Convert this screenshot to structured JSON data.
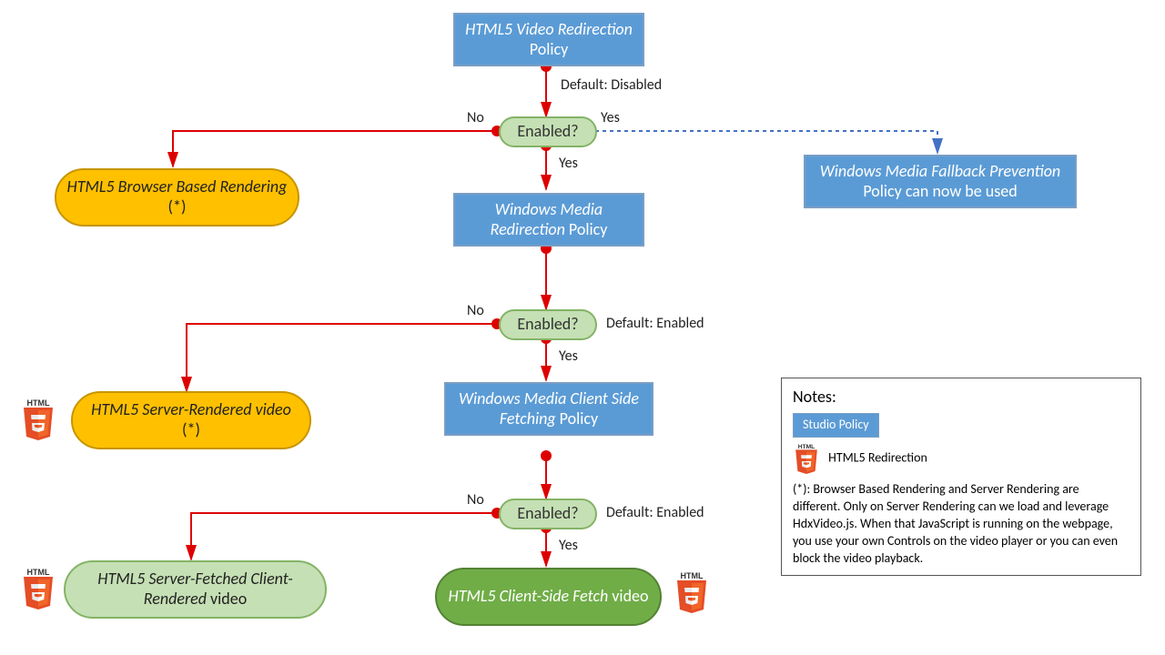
{
  "policy1": {
    "italic": "HTML5 Video Redirection",
    "plain": " Policy"
  },
  "policy2": {
    "italic": "Windows Media Redirection",
    "plain": " Policy"
  },
  "policy3": {
    "italic": "Windows Media Client Side Fetching",
    "plain": " Policy"
  },
  "fallback": {
    "italic": "Windows Media Fallback Prevention",
    "plain": " Policy can now be used"
  },
  "decision1": "Enabled?",
  "decision2": "Enabled?",
  "decision3": "Enabled?",
  "labels": {
    "defaultDisabled": "Default: Disabled",
    "defaultEnabled1": "Default: Enabled",
    "defaultEnabled2": "Default: Enabled",
    "no1": "No",
    "yes1": "Yes",
    "yes1b": "Yes",
    "no2": "No",
    "yes2": "Yes",
    "no3": "No",
    "yes3": "Yes"
  },
  "outcome1": {
    "italic": "HTML5 Browser Based Rendering",
    "plain": " (*)"
  },
  "outcome2": {
    "italic": "HTML5 Server-Rendered video",
    "plain": " (*)"
  },
  "outcome3": {
    "italic": "HTML5 Server-Fetched Client-Rendered",
    "plain": " video"
  },
  "outcome4": {
    "italic": "HTML5 Client-Side Fetch",
    "plain": " video"
  },
  "notes": {
    "title": "Notes:",
    "studio": "Studio Policy",
    "redir": "HTML5 Redirection",
    "body": "(*): Browser Based Rendering  and Server Rendering are different. Only on Server Rendering can we load and leverage HdxVideo.js. When that JavaScript is running on the webpage,  you use your own Controls on the video player or you can even block the video playback."
  }
}
